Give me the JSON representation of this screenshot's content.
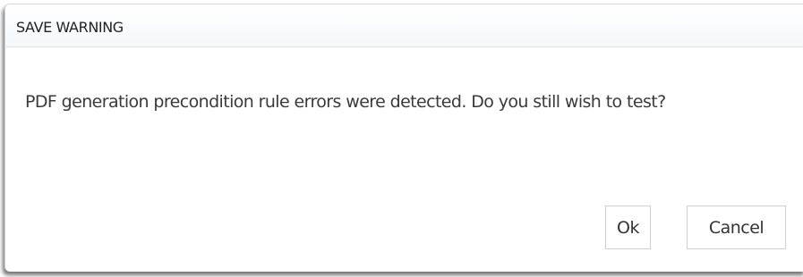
{
  "dialog": {
    "title": "SAVE WARNING",
    "message": "PDF generation precondition rule errors were detected. Do you still wish to test?",
    "buttons": {
      "ok_label": "Ok",
      "cancel_label": "Cancel"
    }
  }
}
